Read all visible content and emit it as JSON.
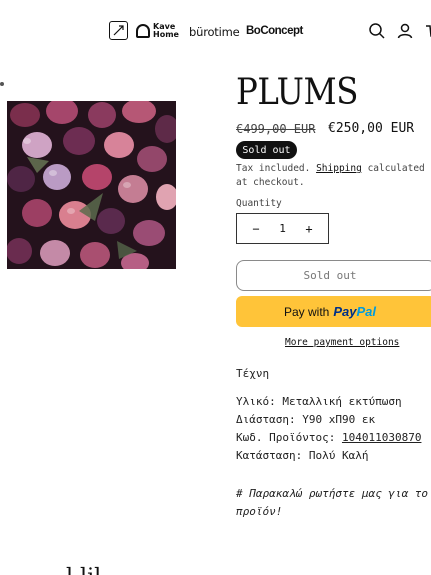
{
  "header": {
    "brands": {
      "mark_text": "⟋",
      "kave_home": "Kave\nHome",
      "burotime": "bürotime",
      "boconcept": "BoConcept"
    },
    "icons": [
      "search-icon",
      "account-icon",
      "cart-icon"
    ]
  },
  "product": {
    "title": "PLUMS",
    "price_old": "€499,00 EUR",
    "price_new": "€250,00 EUR",
    "badge": "Sold out",
    "tax_prefix": "Tax included. ",
    "tax_link": "Shipping",
    "tax_suffix": " calculated at checkout.",
    "quantity_label": "Quantity",
    "quantity_value": "1",
    "quantity_minus": "−",
    "quantity_plus": "+",
    "soldout_button": "Sold out",
    "paypal_with": "Pay with",
    "paypal_pay": "Pay",
    "paypal_pal": "Pal",
    "more_payment": "More payment options"
  },
  "description": {
    "category": "Τέχνη",
    "material": "Υλικό: Μεταλλική εκτύπωση",
    "dimension": "Διάσταση: Υ90 xΠ90 εκ",
    "code_label": "Κωδ. Προϊόντος: ",
    "code_value": "104011030870",
    "condition": "Κατάσταση: Πολύ Καλή",
    "note": "# Παρακαλώ ρωτήστε μας για το προϊόν!"
  },
  "footer": {
    "partial_title": "l  lil"
  },
  "colors": {
    "paypal_yellow": "#ffc439",
    "paypal_dark_blue": "#003087",
    "paypal_light_blue": "#009cde",
    "badge_bg": "#111111"
  }
}
